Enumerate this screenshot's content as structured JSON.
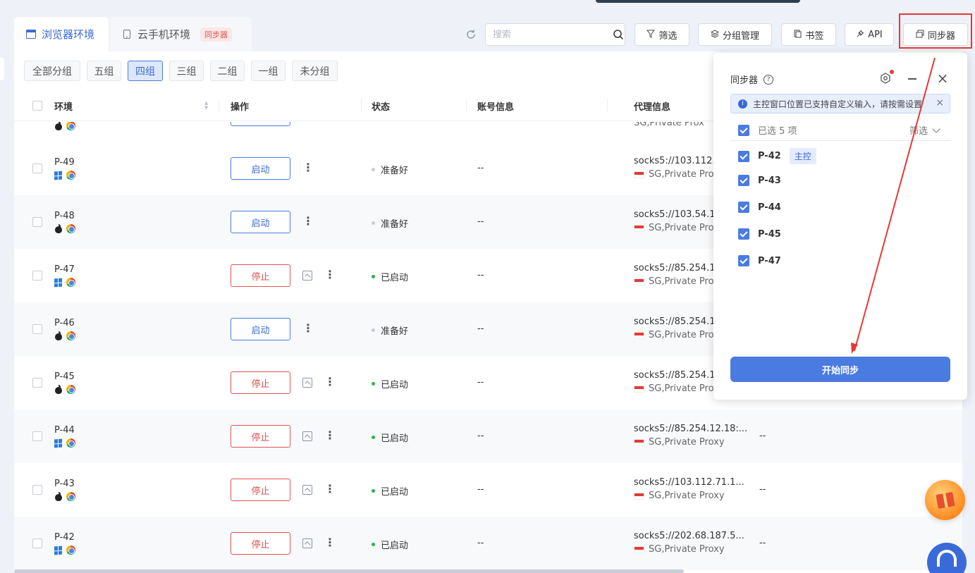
{
  "tabs": [
    {
      "label": "浏览器环境"
    },
    {
      "label": "云手机环境",
      "badge": "同步器"
    }
  ],
  "toolbar": {
    "search_placeholder": "搜索",
    "filter": "筛选",
    "group_manage": "分组管理",
    "bookmarks": "书签",
    "api": "API",
    "sync": "同步器"
  },
  "groups": [
    "全部分组",
    "五组",
    "四组",
    "三组",
    "二组",
    "一组",
    "未分组"
  ],
  "active_group": "四组",
  "columns": [
    "环境",
    "操作",
    "状态",
    "账号信息",
    "代理信息"
  ],
  "rows": [
    {
      "name": "P-49",
      "os": "windows",
      "action": "启动",
      "status": "准备好",
      "account": "--",
      "proxy": "socks5://103.112.6",
      "proxy_loc": "SG,Private Prox"
    },
    {
      "name": "P-48",
      "os": "mac",
      "action": "启动",
      "status": "准备好",
      "account": "--",
      "proxy": "socks5://103.54.15",
      "proxy_loc": "SG,Private Prox"
    },
    {
      "name": "P-47",
      "os": "windows",
      "action": "停止",
      "status": "已启动",
      "account": "--",
      "proxy": "socks5://85.254.12",
      "proxy_loc": "SG,Private Prox"
    },
    {
      "name": "P-46",
      "os": "mac",
      "action": "启动",
      "status": "准备好",
      "account": "--",
      "proxy": "socks5://85.254.12",
      "proxy_loc": "SG,Private Prox"
    },
    {
      "name": "P-45",
      "os": "mac",
      "action": "停止",
      "status": "已启动",
      "account": "--",
      "proxy": "socks5://85.254.12",
      "proxy_loc": "SG,Private Prox"
    },
    {
      "name": "P-44",
      "os": "windows",
      "action": "停止",
      "status": "已启动",
      "account": "--",
      "proxy": "socks5://85.254.12.18:...",
      "proxy_loc": "SG,Private Proxy",
      "extra": "--"
    },
    {
      "name": "P-43",
      "os": "mac",
      "action": "停止",
      "status": "已启动",
      "account": "--",
      "proxy": "socks5://103.112.71.1...",
      "proxy_loc": "SG,Private Proxy",
      "extra": "--"
    },
    {
      "name": "P-42",
      "os": "windows",
      "action": "停止",
      "status": "已启动",
      "account": "--",
      "proxy": "socks5://202.68.187.5...",
      "proxy_loc": "SG,Private Proxy",
      "extra": "--"
    }
  ],
  "partial_row_proxy_loc": "SG,Private Prox",
  "sync_popup": {
    "title": "同步器",
    "info": "主控窗口位置已支持自定义输入，请按需设置",
    "selected": "已选 5 项",
    "filter": "筛选",
    "items": [
      {
        "name": "P-42",
        "badge": "主控"
      },
      {
        "name": "P-43"
      },
      {
        "name": "P-44"
      },
      {
        "name": "P-45"
      },
      {
        "name": "P-47"
      }
    ],
    "start_button": "开始同步"
  },
  "colors": {
    "accent": "#4a7be0",
    "stop": "#e05353",
    "running": "#2bb24c",
    "highlight": "#e53935"
  }
}
